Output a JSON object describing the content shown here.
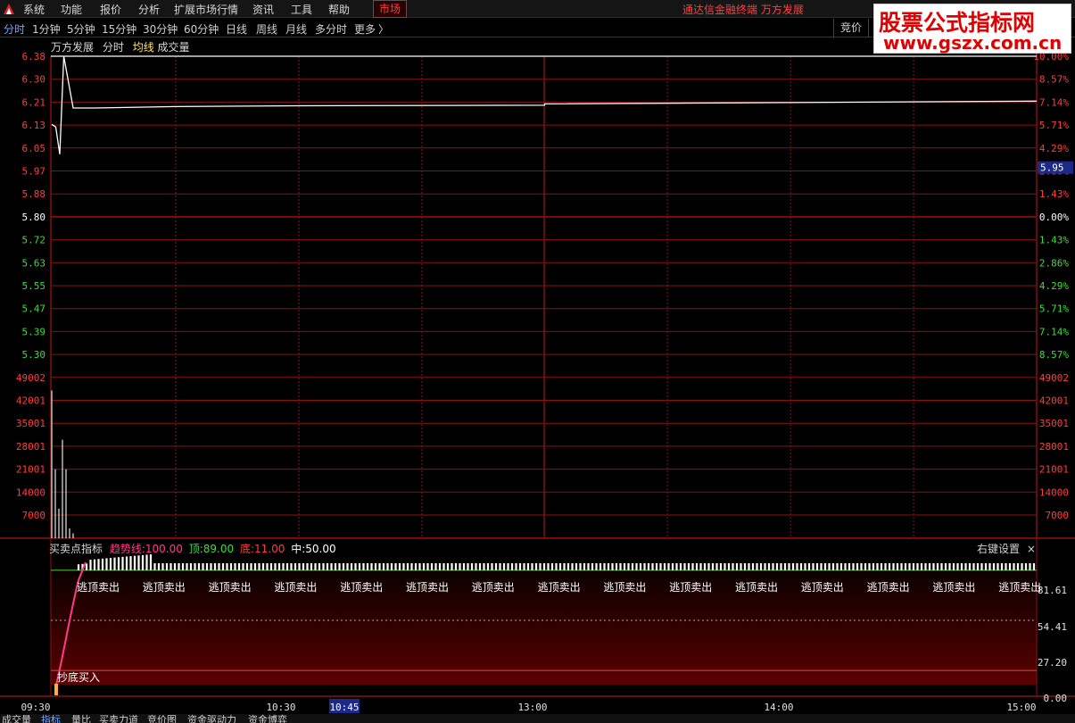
{
  "menu": {
    "items": [
      "系统",
      "功能",
      "报价",
      "分析",
      "扩展市场行情",
      "资讯",
      "工具",
      "帮助"
    ],
    "market": "市场",
    "window_title": "通达信金融终端  万方发展"
  },
  "periods": {
    "items": [
      "分时",
      "1分钟",
      "5分钟",
      "15分钟",
      "30分钟",
      "60分钟",
      "日线",
      "周线",
      "月线",
      "多分时",
      "更多"
    ],
    "active": "分时",
    "more_arrow": "〉",
    "right_label": "竞价"
  },
  "watermark": {
    "line1": "股票公式指标网",
    "line2": "www.gszx.com.cn"
  },
  "stock": {
    "name": "万方发展",
    "view": "分时",
    "ma_label": "均线",
    "vol_label": "成交量"
  },
  "price_axis": {
    "left": [
      "6.38",
      "6.30",
      "6.21",
      "6.13",
      "6.05",
      "5.97",
      "5.88",
      "5.80",
      "5.72",
      "5.63",
      "5.55",
      "5.47",
      "5.39",
      "5.30"
    ],
    "right": [
      "10.00%",
      "8.57%",
      "7.14%",
      "5.71%",
      "4.29%",
      "2.86%",
      "1.43%",
      "0.00%",
      "1.43%",
      "2.86%",
      "4.29%",
      "5.71%",
      "7.14%",
      "8.57%"
    ],
    "prev_close": "5.80",
    "current_price_tag": "5.95"
  },
  "volume_axis": {
    "labels": [
      "49002",
      "42001",
      "35001",
      "28001",
      "21001",
      "14000",
      "7000"
    ]
  },
  "indicator": {
    "name": "买卖点指标",
    "trend_label": "趋势线:",
    "trend_value": "100.00",
    "top_label": "顶:",
    "top_value": "89.00",
    "bottom_label": "底:",
    "bottom_value": "11.00",
    "mid_label": "中:",
    "mid_value": "50.00",
    "settings": "右键设置",
    "close_icon": "×",
    "axis": [
      "81.61",
      "54.41",
      "27.20",
      "0.00"
    ],
    "sell_signal": "逃顶卖出",
    "buy_signal": "抄底买入"
  },
  "time_axis": {
    "labels": [
      "09:30",
      "10:30",
      "13:00",
      "14:00",
      "15:00"
    ],
    "cursor": "10:45"
  },
  "bottom_tabs": {
    "items": [
      "成交量",
      "指标",
      "量比",
      "买卖力道",
      "竞价图",
      "资金驱动力",
      "资金博弈"
    ],
    "active": "指标"
  },
  "chart_data": {
    "type": "line",
    "series": [
      {
        "name": "price",
        "x": [
          "09:30",
          "09:31",
          "09:32",
          "09:33",
          "09:35",
          "09:40",
          "10:00",
          "10:30",
          "11:30",
          "13:00",
          "14:00",
          "15:00"
        ],
        "values": [
          6.13,
          6.12,
          6.02,
          6.38,
          6.19,
          6.19,
          6.195,
          6.198,
          6.2,
          6.205,
          6.21,
          6.215
        ]
      },
      {
        "name": "volume",
        "x": [
          "09:30",
          "09:31",
          "09:32",
          "09:33",
          "09:34",
          "09:35",
          "09:36"
        ],
        "values": [
          45000,
          21000,
          9000,
          30000,
          21000,
          3000,
          1500
        ]
      }
    ],
    "ylim": [
      5.22,
      6.38
    ]
  },
  "colors": {
    "grid": "#8c1010",
    "axis_up": "#ff3c3c",
    "axis_down": "#3cdc3c",
    "line": "#ffffff",
    "trend": "#ff3c8c",
    "top": "#3cdc3c",
    "bottom": "#ff3c3c",
    "mid": "#ffffff",
    "accent": "#6fa8ff"
  }
}
